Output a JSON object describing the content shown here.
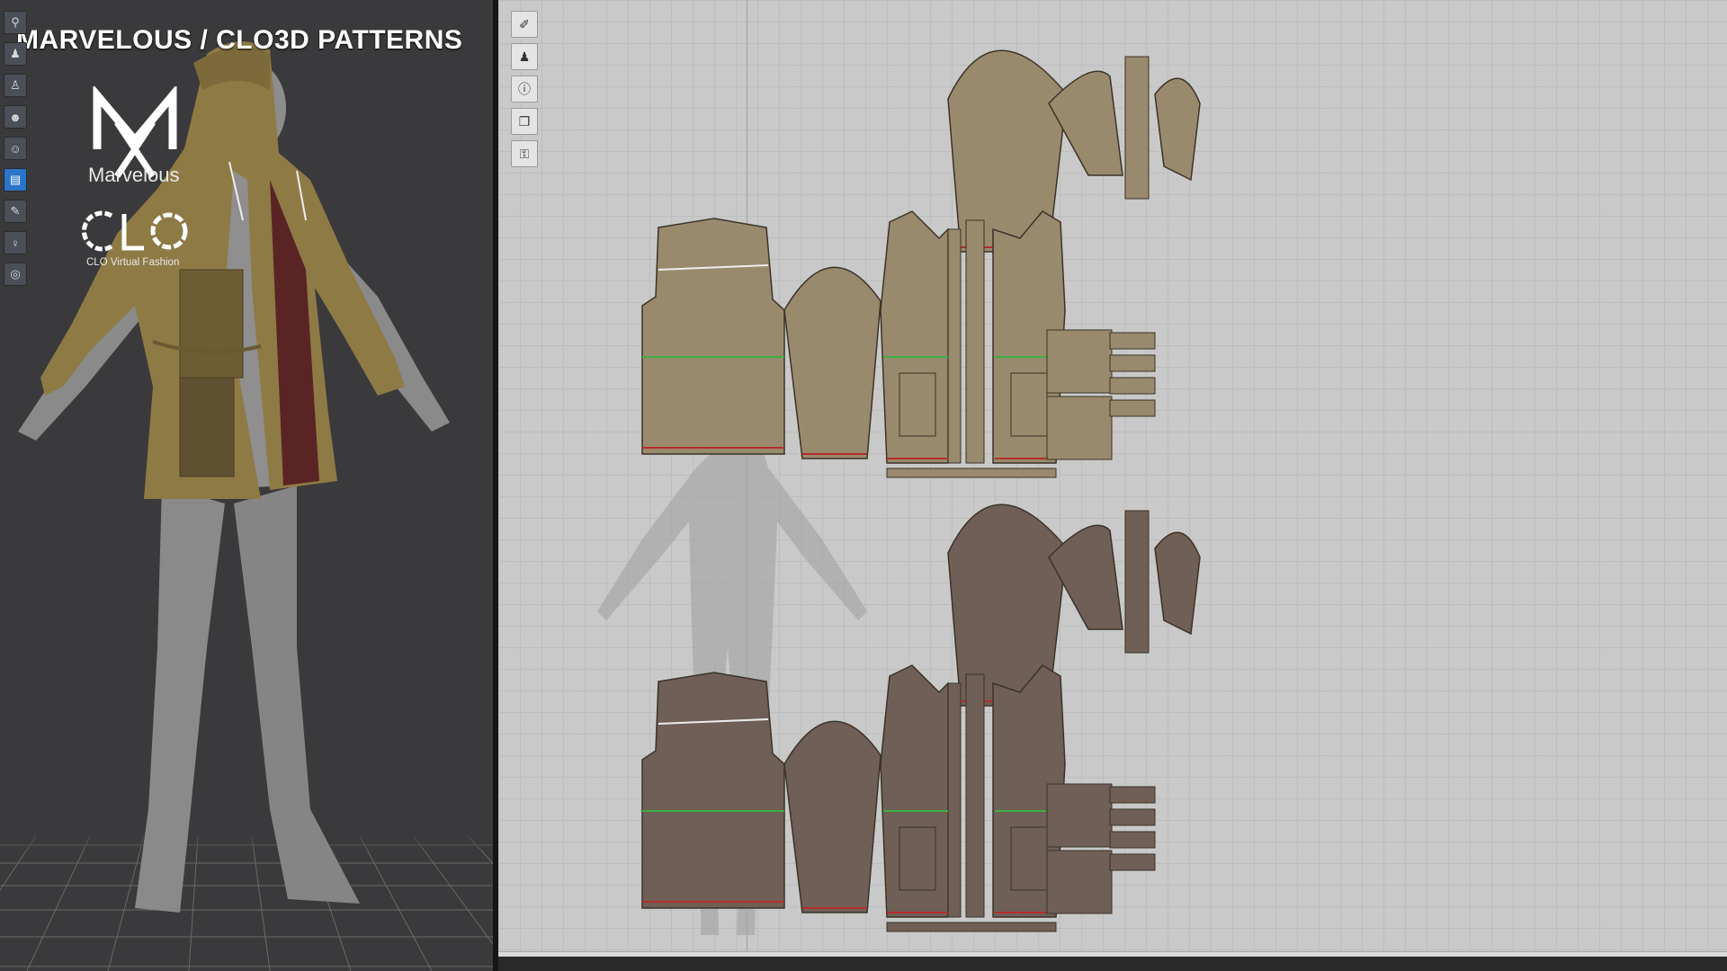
{
  "title": "MARVELOUS / CLO3D PATTERNS",
  "logos": {
    "marvelous_label": "Marvelous",
    "clo_label": "CLO Virtual Fashion"
  },
  "toolbar_3d": [
    {
      "name": "hanger-icon",
      "glyph": "⚲"
    },
    {
      "name": "shirt-icon",
      "glyph": "♟"
    },
    {
      "name": "garment-icon",
      "glyph": "♙"
    },
    {
      "name": "avatar-move-icon",
      "glyph": "☻"
    },
    {
      "name": "avatar-icon",
      "glyph": "☺"
    },
    {
      "name": "fabric-icon",
      "glyph": "▤"
    },
    {
      "name": "brush-icon",
      "glyph": "✎"
    },
    {
      "name": "person-icon",
      "glyph": "♀"
    },
    {
      "name": "globe-icon",
      "glyph": "◎"
    }
  ],
  "toolbar_2d": [
    {
      "name": "pen-icon",
      "glyph": "✐"
    },
    {
      "name": "shirt-view-icon",
      "glyph": "♟"
    },
    {
      "name": "info-icon",
      "glyph": "ⓘ"
    },
    {
      "name": "layers-icon",
      "glyph": "❐"
    },
    {
      "name": "lock-shirt-icon",
      "glyph": "⚿"
    }
  ],
  "colors": {
    "fabric_top": "#9a8a6d",
    "fabric_bottom": "#6f5f57",
    "stitch": "#b52d2d",
    "accent": "#2a74c9",
    "viewport_bg": "#3a3a3c",
    "grid_bg": "#c9c9c9"
  }
}
